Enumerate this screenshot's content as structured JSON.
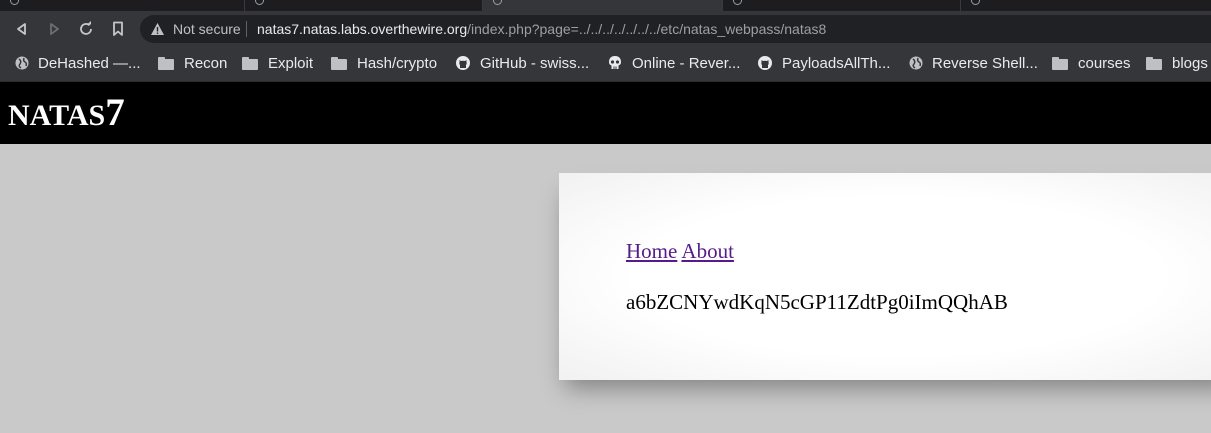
{
  "browser": {
    "back_icon": "back-arrow-icon",
    "forward_icon": "forward-arrow-icon",
    "reload_icon": "reload-icon",
    "bookmark_icon": "bookmark-icon",
    "security_text": "Not secure",
    "url_host": "natas7.natas.labs.overthewire.org",
    "url_path": "/index.php?page=../../../../../../../etc/natas_webpass/natas8"
  },
  "bookmarks": [
    {
      "label": "DeHashed —...",
      "icon": "globe-icon"
    },
    {
      "label": "Recon",
      "icon": "folder-icon"
    },
    {
      "label": "Exploit",
      "icon": "folder-icon"
    },
    {
      "label": "Hash/crypto",
      "icon": "folder-icon"
    },
    {
      "label": "GitHub - swiss...",
      "icon": "github-icon"
    },
    {
      "label": "Online - Rever...",
      "icon": "skull-icon"
    },
    {
      "label": "PayloadsAllTh...",
      "icon": "github-icon"
    },
    {
      "label": "Reverse Shell...",
      "icon": "globe-icon"
    },
    {
      "label": "courses",
      "icon": "folder-icon"
    },
    {
      "label": "blogs",
      "icon": "folder-icon"
    }
  ],
  "page": {
    "title_prefix": "NATAS",
    "title_number": "7",
    "nav": {
      "home": "Home",
      "about": "About"
    },
    "secret": "a6bZCNYwdKqN5cGP11ZdtPg0iImQQhAB"
  },
  "colors": {
    "header_bg": "#000000",
    "page_bg": "#c9c9c9",
    "link_visited": "#551a8b"
  }
}
